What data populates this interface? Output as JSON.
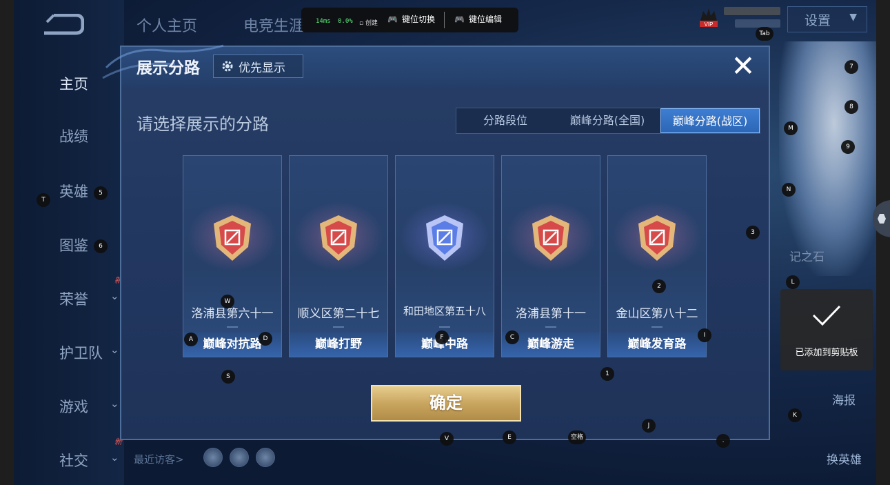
{
  "sidebar": {
    "items": [
      {
        "label": "主页",
        "chev": false,
        "new": false
      },
      {
        "label": "战绩",
        "chev": false,
        "new": false
      },
      {
        "label": "英雄",
        "chev": false,
        "new": false
      },
      {
        "label": "图鉴",
        "chev": false,
        "new": false
      },
      {
        "label": "荣誉",
        "chev": true,
        "new": true
      },
      {
        "label": "护卫队",
        "chev": true,
        "new": false
      },
      {
        "label": "游戏",
        "chev": true,
        "new": false
      },
      {
        "label": "社交",
        "chev": true,
        "new": true
      }
    ],
    "new_badge": "新"
  },
  "top_tabs": [
    "个人主页",
    "电竞生涯"
  ],
  "toolbar": {
    "ping": "14ms",
    "loss": "0.0%",
    "create_label": "创建",
    "key_switch": "键位切换",
    "key_edit": "键位编辑"
  },
  "header": {
    "settings_label": "设置",
    "vip_label": "VIP"
  },
  "right_panel": {
    "stone_text": "记之石",
    "poster_label": "海报",
    "swap_hero_label": "换英雄"
  },
  "footer": {
    "recent_visitors_label": "最近访客>"
  },
  "modal": {
    "title": "展示分路",
    "priority_label": "优先显示",
    "close_symbol": "✕",
    "prompt": "请选择展示的分路",
    "segments": [
      {
        "label": "分路段位",
        "active": false
      },
      {
        "label": "巅峰分路(全国)",
        "active": false
      },
      {
        "label": "巅峰分路(战区)",
        "active": true
      }
    ],
    "cards": [
      {
        "region": "洛浦县第六十一",
        "lane": "巅峰对抗路",
        "badge_color": "#d64a4a",
        "blue": false
      },
      {
        "region": "顺义区第二十七",
        "lane": "巅峰打野",
        "badge_color": "#d64a4a",
        "blue": false
      },
      {
        "region": "和田地区第五十八",
        "lane": "巅峰中路",
        "badge_color": "#5b7de6",
        "blue": true
      },
      {
        "region": "洛浦县第十一",
        "lane": "巅峰游走",
        "badge_color": "#d64a4a",
        "blue": false
      },
      {
        "region": "金山区第八十二",
        "lane": "巅峰发育路",
        "badge_color": "#d64a4a",
        "blue": false
      }
    ],
    "confirm_label": "确定"
  },
  "toast": {
    "text": "已添加到剪贴板"
  },
  "key_markers": [
    "Tab",
    "7",
    "8",
    "M",
    "9",
    "N",
    "5",
    "T",
    "3",
    "6",
    "L",
    "2",
    "W",
    "A",
    "D",
    "F",
    "C",
    "I",
    "S",
    "1",
    "K",
    "J",
    "V",
    "E",
    "空格",
    "."
  ]
}
